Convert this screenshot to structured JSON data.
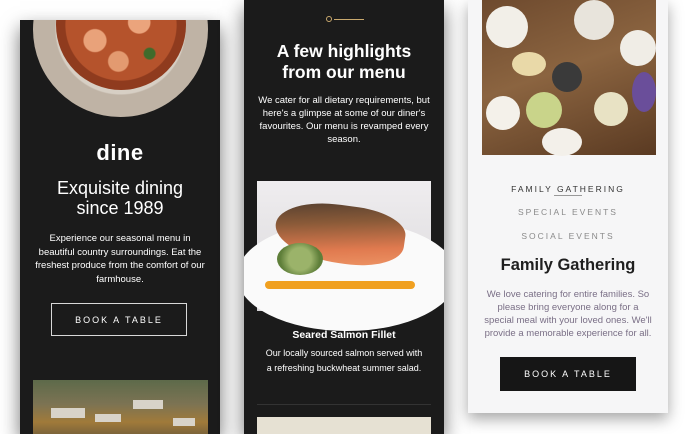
{
  "panel1": {
    "brand": "dine",
    "title_line1": "Exquisite dining",
    "title_line2": "since 1989",
    "description": "Experience our seasonal menu in beautiful country surroundings. Eat the freshest produce from the comfort of our farmhouse.",
    "button_label": "BOOK A TABLE"
  },
  "panel2": {
    "title_line1": "A few highlights",
    "title_line2": "from our menu",
    "description": "We cater for all dietary requirements, but here's a glimpse at some of our diner's favourites. Our menu is revamped every season.",
    "dish_name": "Seared Salmon Fillet",
    "dish_description": "Our locally sourced salmon served with a refreshing buckwheat summer salad."
  },
  "panel3": {
    "tabs": [
      "FAMILY GATHERING",
      "SPECIAL EVENTS",
      "SOCIAL EVENTS"
    ],
    "title": "Family Gathering",
    "description": "We love catering for entire families. So please bring everyone along for a special meal with your loved ones. We'll provide a memorable experience for all.",
    "button_label": "BOOK A TABLE"
  },
  "colors": {
    "dark_panel": "#1b1b1b",
    "light_panel": "#f6f6f7",
    "accent_gold": "#c9a96e",
    "button_dark": "#161616"
  }
}
